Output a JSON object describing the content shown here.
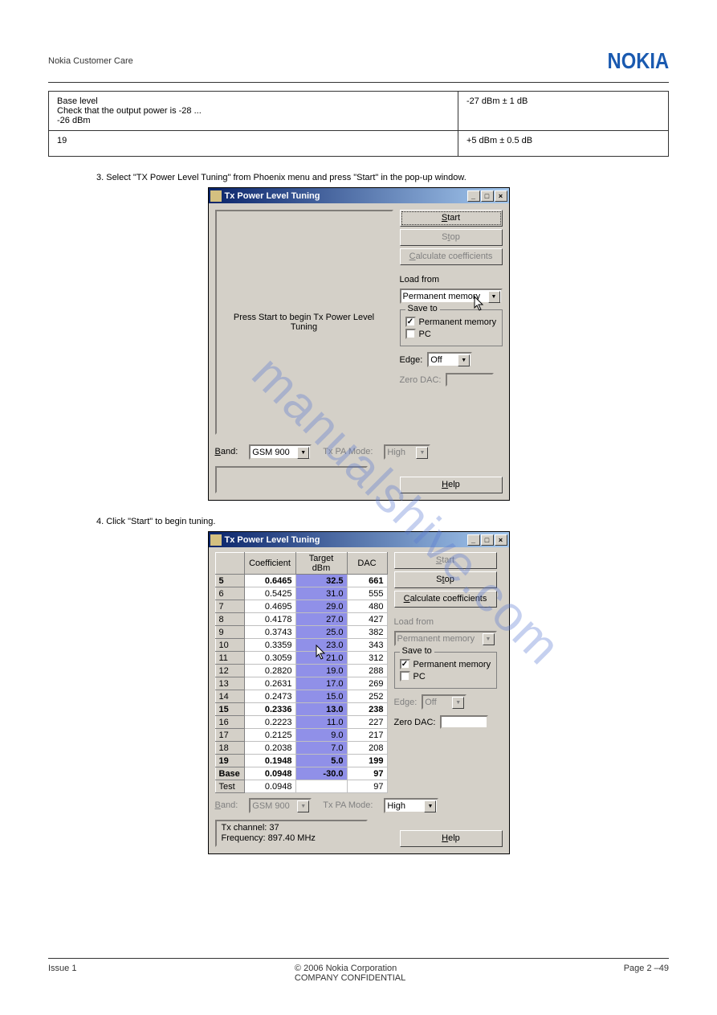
{
  "header": {
    "left": "Nokia Customer Care",
    "brand": "NOKIA"
  },
  "info_table": {
    "r1c1": "Base level\nCheck that the output power is -28 ...\n-26 dBm",
    "r1c2": "-27 dBm ± 1 dB",
    "r2c1": "19",
    "r2c2": "+5 dBm ± 0.5 dB"
  },
  "instructions": {
    "i1": "3. Select \"TX Power Level Tuning\" from Phoenix menu and press \"Start\" in the pop-up window.",
    "i2": "4. Click \"Start\" to begin tuning."
  },
  "win": {
    "title": "Tx Power Level Tuning",
    "msg": "Press Start to begin Tx Power Level Tuning",
    "start": "Start",
    "stop": "Stop",
    "calc": "Calculate coefficients",
    "help": "Help",
    "loadfrom": "Load from",
    "loadfrom_val": "Permanent memory",
    "saveto": "Save to",
    "perm": "Permanent memory",
    "pc": "PC",
    "edge": "Edge:",
    "edge_val": "Off",
    "zerodac": "Zero DAC:",
    "band": "Band:",
    "band_val": "GSM 900",
    "txpa": "Tx PA Mode:",
    "txpa_val": "High"
  },
  "win2": {
    "cols": {
      "blank": "",
      "coef": "Coefficient",
      "tgt": "Target dBm",
      "dac": "DAC"
    },
    "rows": [
      {
        "k": "5",
        "c": "0.6465",
        "t": "32.5",
        "d": "661",
        "bold": true
      },
      {
        "k": "6",
        "c": "0.5425",
        "t": "31.0",
        "d": "555"
      },
      {
        "k": "7",
        "c": "0.4695",
        "t": "29.0",
        "d": "480"
      },
      {
        "k": "8",
        "c": "0.4178",
        "t": "27.0",
        "d": "427"
      },
      {
        "k": "9",
        "c": "0.3743",
        "t": "25.0",
        "d": "382"
      },
      {
        "k": "10",
        "c": "0.3359",
        "t": "23.0",
        "d": "343"
      },
      {
        "k": "11",
        "c": "0.3059",
        "t": "21.0",
        "d": "312"
      },
      {
        "k": "12",
        "c": "0.2820",
        "t": "19.0",
        "d": "288"
      },
      {
        "k": "13",
        "c": "0.2631",
        "t": "17.0",
        "d": "269"
      },
      {
        "k": "14",
        "c": "0.2473",
        "t": "15.0",
        "d": "252"
      },
      {
        "k": "15",
        "c": "0.2336",
        "t": "13.0",
        "d": "238",
        "bold": true
      },
      {
        "k": "16",
        "c": "0.2223",
        "t": "11.0",
        "d": "227"
      },
      {
        "k": "17",
        "c": "0.2125",
        "t": "9.0",
        "d": "217"
      },
      {
        "k": "18",
        "c": "0.2038",
        "t": "7.0",
        "d": "208"
      },
      {
        "k": "19",
        "c": "0.1948",
        "t": "5.0",
        "d": "199",
        "bold": true
      },
      {
        "k": "Base",
        "c": "0.0948",
        "t": "-30.0",
        "d": "97",
        "bold": true
      },
      {
        "k": "Test",
        "c": "0.0948",
        "t": "",
        "d": "97"
      }
    ],
    "status1": "Tx channel: 37",
    "status2": "Frequency:  897.40 MHz"
  },
  "footer": {
    "left": "Issue 1",
    "center": "© 2006 Nokia Corporation",
    "right": "Page 2 –49",
    "confidential": "COMPANY CONFIDENTIAL"
  },
  "watermark": "manualshive.com"
}
